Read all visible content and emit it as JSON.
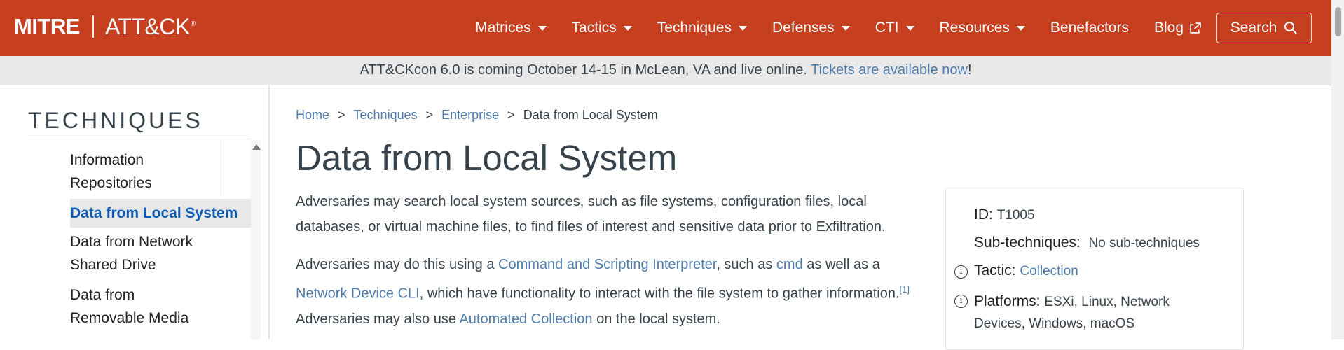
{
  "brand": {
    "mitre": "MITRE",
    "attack": "ATT&CK",
    "reg": "®"
  },
  "nav": {
    "items": [
      {
        "label": "Matrices",
        "dropdown": true
      },
      {
        "label": "Tactics",
        "dropdown": true
      },
      {
        "label": "Techniques",
        "dropdown": true
      },
      {
        "label": "Defenses",
        "dropdown": true
      },
      {
        "label": "CTI",
        "dropdown": true
      },
      {
        "label": "Resources",
        "dropdown": true
      },
      {
        "label": "Benefactors",
        "dropdown": false
      },
      {
        "label": "Blog",
        "dropdown": false,
        "icon": "external-link-icon"
      }
    ],
    "search_label": "Search"
  },
  "banner": {
    "text": "ATT&CKcon 6.0 is coming October 14-15 in McLean, VA and live online. ",
    "link": "Tickets are available now",
    "suffix": "!"
  },
  "sidebar": {
    "title": "TECHNIQUES",
    "items": [
      {
        "label": "Information Repositories",
        "active": false
      },
      {
        "label": "Data from Local System",
        "active": true
      },
      {
        "label": "Data from Network Shared Drive",
        "active": false
      },
      {
        "label": "Data from Removable Media",
        "active": false
      }
    ]
  },
  "breadcrumb": {
    "home": "Home",
    "techniques": "Techniques",
    "enterprise": "Enterprise",
    "current": "Data from Local System",
    "sep": ">"
  },
  "page": {
    "title": "Data from Local System",
    "p1": "Adversaries may search local system sources, such as file systems, configuration files, local databases, or virtual machine files, to find files of interest and sensitive data prior to Exfiltration.",
    "p2_a": "Adversaries may do this using a ",
    "p2_link1": "Command and Scripting Interpreter",
    "p2_b": ", such as ",
    "p2_link2": "cmd",
    "p2_c": " as well as a ",
    "p2_link3": "Network Device CLI",
    "p2_d": ", which have functionality to interact with the file system to gather information.",
    "p2_ref": "[1]",
    "p2_e": " Adversaries may also use ",
    "p2_link4": "Automated Collection",
    "p2_f": " on the local system."
  },
  "card": {
    "id_label": "ID:",
    "id_value": "T1005",
    "sub_label": "Sub-techniques:",
    "sub_value": "No sub-techniques",
    "tactic_label": "Tactic:",
    "tactic_value": "Collection",
    "platforms_label": "Platforms:",
    "platforms_value": "ESXi, Linux, Network Devices, Windows, macOS"
  },
  "colors": {
    "nav_bg": "#c63f1f",
    "link": "#4f7cac",
    "active_link": "#0d5db8",
    "banner_bg": "#e9e9e9"
  }
}
